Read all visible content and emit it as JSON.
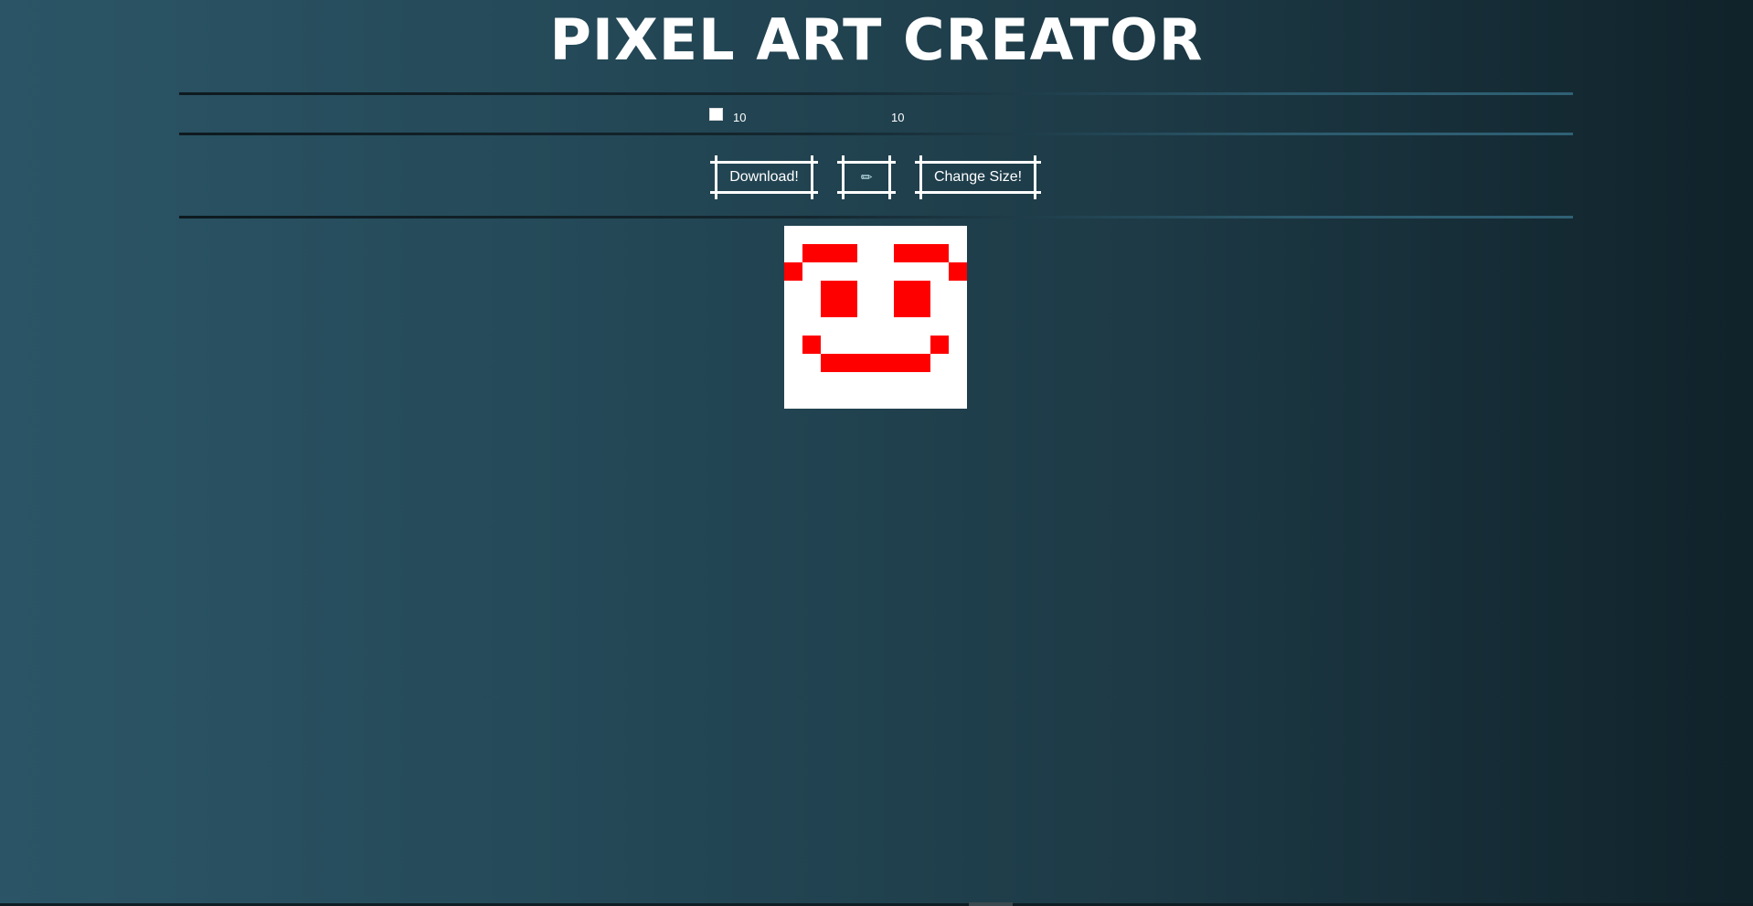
{
  "app": {
    "title": "PIXEL ART CREATOR"
  },
  "controls": {
    "color_value": "#ffffff",
    "width_value": "10",
    "height_value": "10"
  },
  "buttons": {
    "download_label": "Download!",
    "eraser_icon": "pencil-eraser-icon",
    "eraser_label": "✎",
    "change_size_label": "Change Size!"
  },
  "canvas": {
    "columns": 10,
    "rows": 10,
    "background_color": "#ffffff",
    "paint_color": "#ff0000",
    "pixels": [
      [
        0,
        0,
        0,
        0,
        0,
        0,
        0,
        0,
        0,
        0
      ],
      [
        0,
        1,
        1,
        1,
        0,
        0,
        1,
        1,
        1,
        0
      ],
      [
        1,
        0,
        0,
        0,
        0,
        0,
        0,
        0,
        0,
        1
      ],
      [
        0,
        0,
        1,
        1,
        0,
        0,
        1,
        1,
        0,
        0
      ],
      [
        0,
        0,
        1,
        1,
        0,
        0,
        1,
        1,
        0,
        0
      ],
      [
        0,
        0,
        0,
        0,
        0,
        0,
        0,
        0,
        0,
        0
      ],
      [
        0,
        1,
        0,
        0,
        0,
        0,
        0,
        0,
        1,
        0
      ],
      [
        0,
        0,
        1,
        1,
        1,
        1,
        1,
        1,
        0,
        0
      ],
      [
        0,
        0,
        0,
        0,
        0,
        0,
        0,
        0,
        0,
        0
      ],
      [
        0,
        0,
        0,
        0,
        0,
        0,
        0,
        0,
        0,
        0
      ]
    ]
  }
}
